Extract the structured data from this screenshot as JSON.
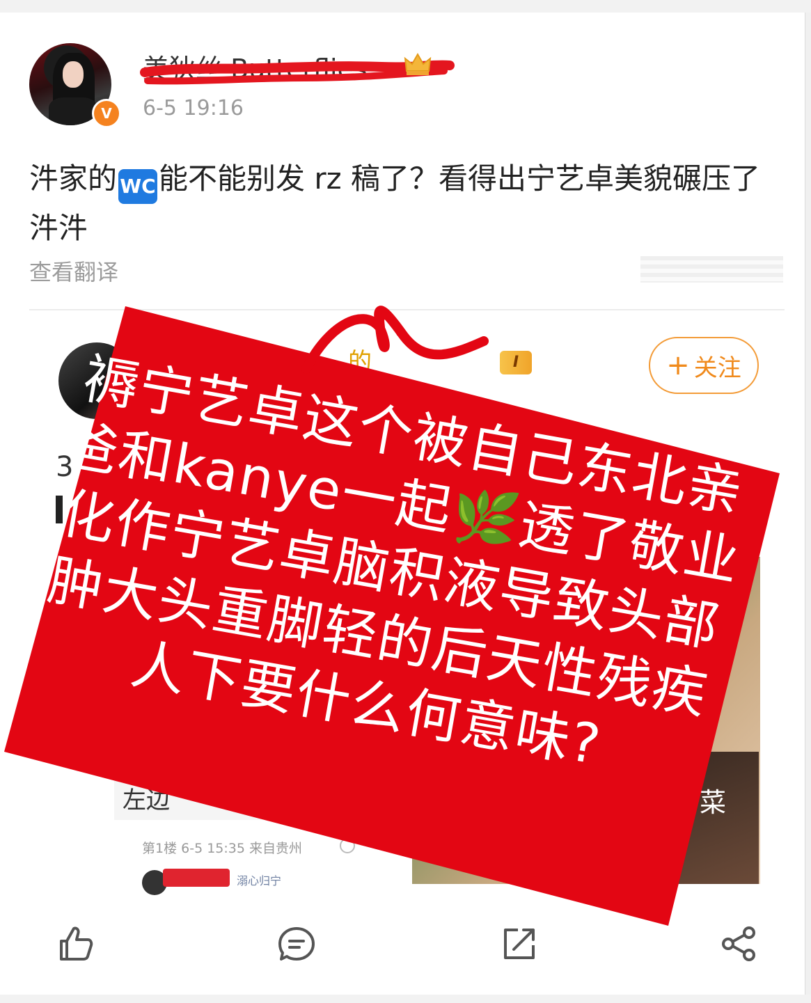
{
  "post": {
    "username": "美狄丝 Butterflies",
    "timestamp": "6-5 19:16",
    "text_before_badge": "汼家的",
    "badge_text": "WC",
    "text_after_badge": "能不能别发 rz 稿了？看得出宁艺卓美貌碾压了汼汼",
    "translate_label": "查看翻译",
    "verified_badge": "V"
  },
  "quoted": {
    "name_partial": "的",
    "level_badge": "I",
    "follow_label": "关注",
    "follow_icon": "plus-icon",
    "number_partial": "3",
    "bottom_text_partial": "左边",
    "right_text_partial": "菜",
    "meta": "第1楼 6-5 15:35 来自贵州",
    "tag_partial": "溺心归宁"
  },
  "overlay": {
    "text": "褥宁艺卓这个被自己东北亲爸和kanye一起🌿透了敬业化作宁艺卓脑积液导致头部肿大头重脚轻的后天性残疾人下要什么何意味?",
    "color": "#e30613"
  },
  "toolbar": {
    "like_icon": "thumbs-up-icon",
    "comment_icon": "comment-icon",
    "repost_icon": "repost-icon",
    "share_icon": "share-icon"
  },
  "colors": {
    "accent_orange": "#f08a1c",
    "badge_blue": "#1f7ae0",
    "note_red": "#e30613",
    "scribble_red": "#e4161f"
  }
}
